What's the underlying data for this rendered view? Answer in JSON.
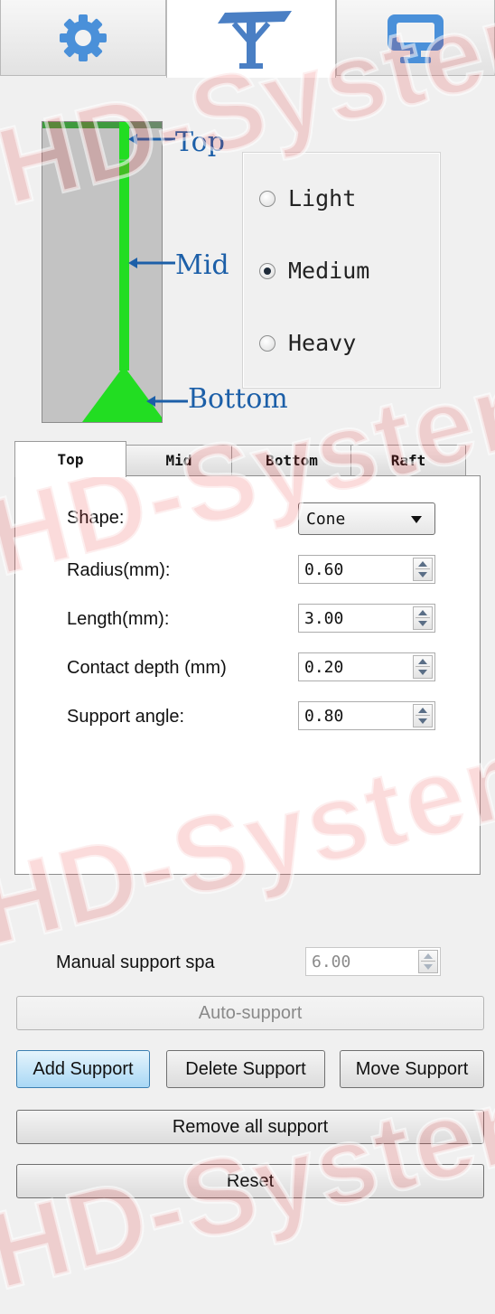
{
  "toolbar": {
    "tabs": [
      {
        "icon": "gear-icon",
        "color": "#4a90d9"
      },
      {
        "icon": "support-icon",
        "color": "#4a7fc4",
        "active": true
      },
      {
        "icon": "monitor-icon",
        "color": "#4a90d9"
      }
    ]
  },
  "diagram": {
    "callouts": {
      "top": "Top",
      "mid": "Mid",
      "bottom": "Bottom"
    },
    "support_color": "#22dd22"
  },
  "presets": {
    "options": [
      "Light",
      "Medium",
      "Heavy"
    ],
    "selected": "Medium"
  },
  "param_tabs": {
    "labels": [
      "Top",
      "Mid",
      "Bottom",
      "Raft"
    ],
    "active": "Top"
  },
  "fields": {
    "shape_label": "Shape:",
    "shape_value": "Cone",
    "radius_label": "Radius(mm):",
    "radius_value": "0.60",
    "length_label": "Length(mm):",
    "length_value": "3.00",
    "contact_label": "Contact depth (mm)",
    "contact_value": "0.20",
    "angle_label": "Support angle:",
    "angle_value": "0.80"
  },
  "manual": {
    "label": "Manual support spa",
    "value": "6.00"
  },
  "buttons": {
    "auto_support": "Auto-support",
    "add_support": "Add Support",
    "delete_support": "Delete Support",
    "move_support": "Move Support",
    "remove_all": "Remove all support",
    "reset": "Reset"
  },
  "watermark": "HD-Systems",
  "colors": {
    "accent": "#3c7fb1",
    "watermark": "#e62828"
  }
}
